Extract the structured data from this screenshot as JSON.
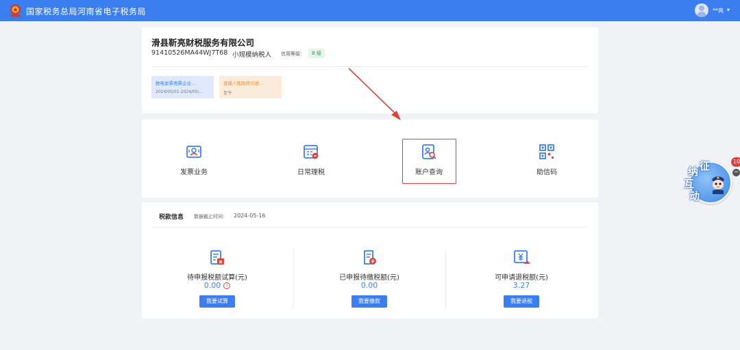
{
  "header": {
    "site_title": "国家税务总局河南省电子税务局",
    "user_name": "**亮",
    "caret": "▾"
  },
  "company": {
    "name": "滑县靳亮财税服务有限公司",
    "credit_code": "91410526MA44WJ7T68",
    "taxpayer_type": "小规模纳税人",
    "credit_label": "信用等级：",
    "credit_grade": "B 级"
  },
  "notices": [
    {
      "title": "数电发票用票企业...",
      "date": "2024/05/01-2024/05/..."
    },
    {
      "title": "查摸人民政府引进...",
      "date": "至今"
    }
  ],
  "menu": [
    {
      "label": "发票业务",
      "icon": "invoice-icon"
    },
    {
      "label": "日常理税",
      "icon": "daily-tax-icon"
    },
    {
      "label": "账户查询",
      "icon": "account-query-icon"
    },
    {
      "label": "助信码",
      "icon": "qr-code-icon"
    }
  ],
  "tax_info": {
    "title": "税款信息",
    "date_label": "数据截止时间:",
    "date_value": "2024-05-16",
    "columns": [
      {
        "label": "待申报税额试算(元)",
        "value": "0.00",
        "button": "我要试算",
        "icon": "tax-calc-icon"
      },
      {
        "label": "已申报待缴税额(元)",
        "value": "0.00",
        "button": "我要缴款",
        "icon": "tax-pay-icon"
      },
      {
        "label": "可申请退税额(元)",
        "value": "3.27",
        "button": "我要退税",
        "icon": "tax-refund-icon"
      }
    ]
  },
  "mascot": {
    "chars": [
      "征",
      "纳",
      "互",
      "动"
    ],
    "badge": "10",
    "minus": "−"
  },
  "colors": {
    "primary": "#3a7ef0",
    "highlight": "#e0403c",
    "background": "#f1f2f5"
  }
}
